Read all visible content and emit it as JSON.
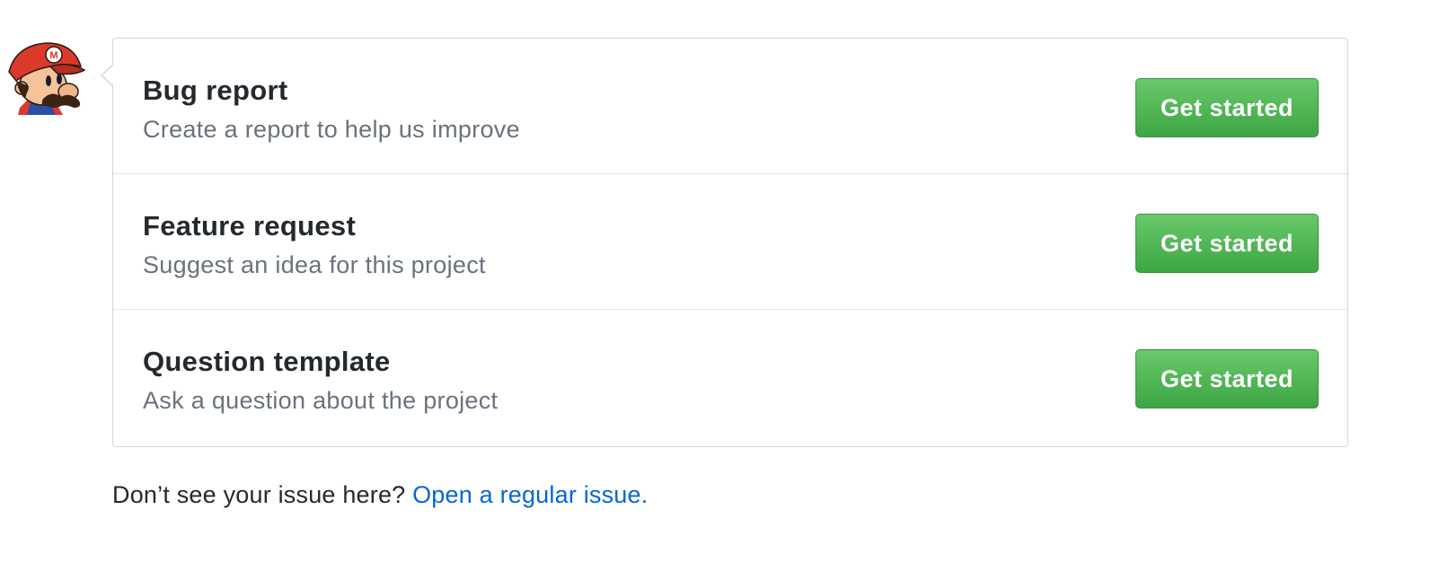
{
  "avatar": {
    "icon": "mario-avatar-icon",
    "colors": {
      "hat": "#d93a2b",
      "skin": "#f5c39a",
      "hair": "#3b2313"
    }
  },
  "templates": [
    {
      "title": "Bug report",
      "description": "Create a report to help us improve",
      "button": "Get started"
    },
    {
      "title": "Feature request",
      "description": "Suggest an idea for this project",
      "button": "Get started"
    },
    {
      "title": "Question template",
      "description": "Ask a question about the project",
      "button": "Get started"
    }
  ],
  "footer": {
    "text": "Don’t see your issue here?",
    "link": "Open a regular issue."
  },
  "colors": {
    "button_green": "#4cb052",
    "link_blue": "#0366d6",
    "muted_text": "#6a737d",
    "border": "#d1d5da"
  }
}
